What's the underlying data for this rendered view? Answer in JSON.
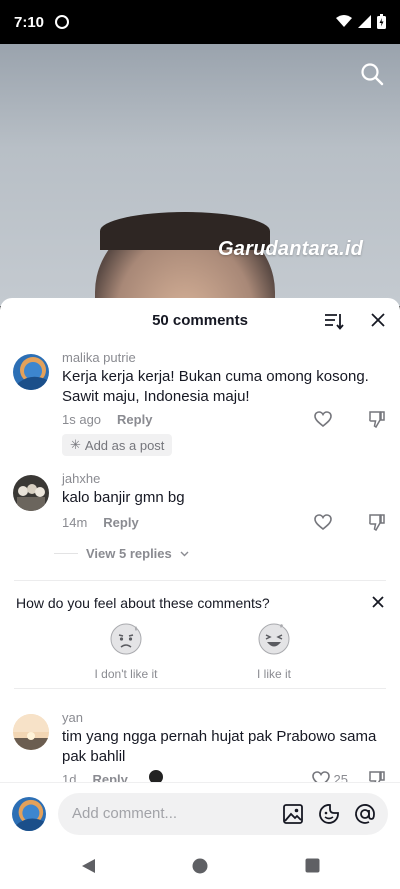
{
  "status": {
    "time": "7:10"
  },
  "video": {
    "watermark": "Garudantara.id"
  },
  "comments_sheet": {
    "title": "50 comments",
    "comments": [
      {
        "user": "malika putrie",
        "text": "Kerja kerja kerja! Bukan cuma omong kosong. Sawit maju, Indonesia maju!",
        "time": "1s ago",
        "reply": "Reply",
        "add_post": "Add as a post"
      },
      {
        "user": "jahxhe",
        "text": "kalo banjir gmn bg",
        "time": "14m",
        "reply": "Reply",
        "view_replies": "View 5 replies"
      },
      {
        "user": "yan",
        "text": "tim yang ngga pernah hujat pak Prabowo sama pak bahlil",
        "time": "1d",
        "reply": "Reply",
        "likes": "25"
      }
    ],
    "feedback": {
      "question": "How do you feel about these comments?",
      "dislike_label": "I don't like it",
      "like_label": "I like it"
    }
  },
  "input": {
    "placeholder": "Add comment..."
  },
  "icons": [
    "search-icon",
    "sort-icon",
    "close-icon",
    "heart-icon",
    "dislike-icon",
    "image-icon",
    "emoji-icon",
    "mention-icon",
    "back-icon",
    "home-icon",
    "recents-icon"
  ]
}
